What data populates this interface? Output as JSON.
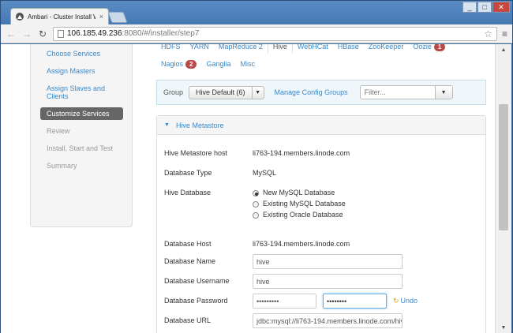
{
  "browser": {
    "tab_title": "Ambari - Cluster Install W",
    "tab_close": "×",
    "url_host": "106.185.49.236",
    "url_rest": ":8080/#/installer/step7",
    "window_buttons": {
      "minimize": "_",
      "maximize": "□",
      "close": "✕"
    },
    "nav": {
      "back": "←",
      "forward": "→",
      "reload": "↻"
    },
    "star": "☆",
    "menu": "≡"
  },
  "sidebar": {
    "steps": [
      {
        "label": "Choose Services",
        "state": "link"
      },
      {
        "label": "Assign Masters",
        "state": "link"
      },
      {
        "label": "Assign Slaves and Clients",
        "state": "link"
      },
      {
        "label": "Customize Services",
        "state": "active"
      },
      {
        "label": "Review",
        "state": "disabled"
      },
      {
        "label": "Install, Start and Test",
        "state": "disabled"
      },
      {
        "label": "Summary",
        "state": "disabled"
      }
    ]
  },
  "service_tabs": {
    "row1": [
      "HDFS",
      "YARN",
      "MapReduce 2",
      "Hive",
      "WebHCat",
      "HBase",
      "ZooKeeper",
      "Oozie"
    ],
    "row1_active": "Hive",
    "oozie_badge": "1",
    "row2": [
      "Nagios",
      "Ganglia",
      "Misc"
    ],
    "nagios_badge": "2"
  },
  "group_bar": {
    "label": "Group",
    "selected_group": "Hive Default (6)",
    "manage_link": "Manage Config Groups",
    "filter_placeholder": "Filter..."
  },
  "panel": {
    "title": "Hive Metastore",
    "fields": {
      "metastore_host": {
        "label": "Hive Metastore host",
        "value": "li763-194.members.linode.com"
      },
      "db_type": {
        "label": "Database Type",
        "value": "MySQL"
      },
      "hive_db": {
        "label": "Hive Database",
        "options": [
          "New MySQL Database",
          "Existing MySQL Database",
          "Existing Oracle Database"
        ],
        "selected": "New MySQL Database"
      },
      "db_host": {
        "label": "Database Host",
        "value": "li763-194.members.linode.com"
      },
      "db_name": {
        "label": "Database Name",
        "value": "hive"
      },
      "db_user": {
        "label": "Database Username",
        "value": "hive"
      },
      "db_password": {
        "label": "Database Password",
        "value": "•••••••••",
        "confirm": "••••••••",
        "undo": "Undo"
      },
      "db_url": {
        "label": "Database URL",
        "value": "jdbc:mysql://li763-194.members.linode.com/hiv"
      }
    }
  },
  "colors": {
    "link": "#3a89c9",
    "active_step": "#666666",
    "badge": "#b94a48"
  }
}
